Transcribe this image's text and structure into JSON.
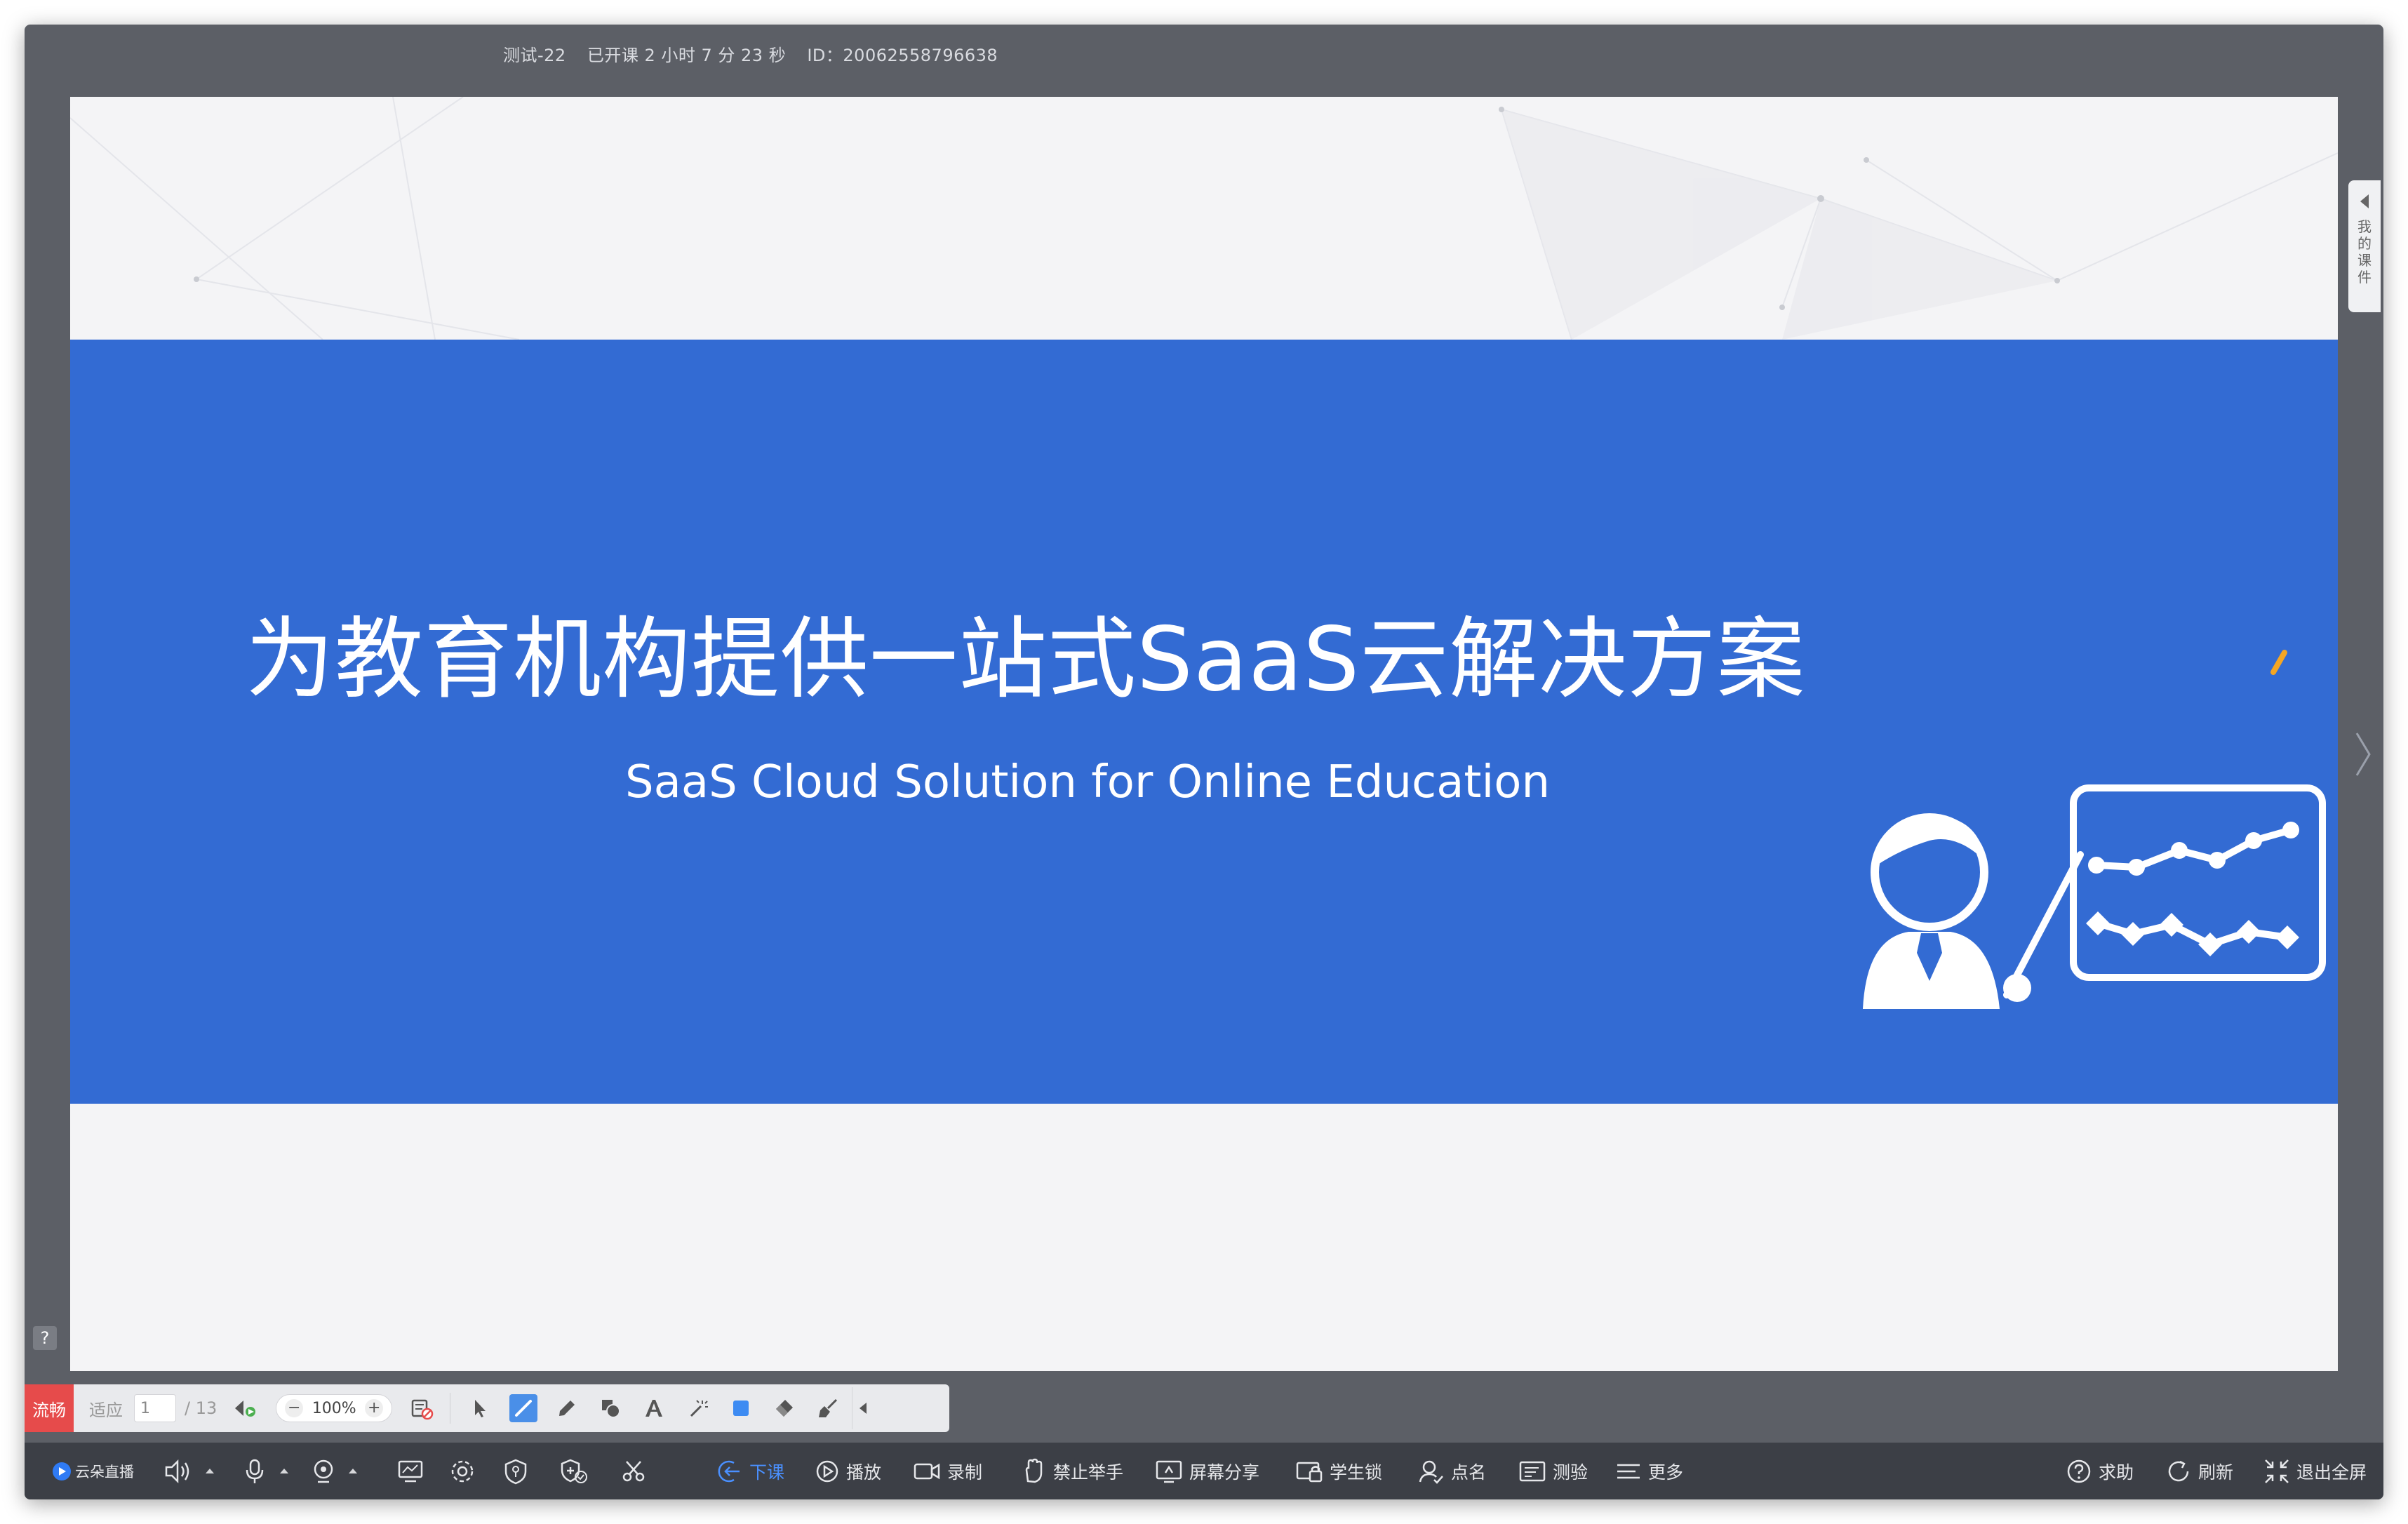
{
  "topbar": {
    "course_name": "测试-22",
    "elapsed": "已开课 2 小时 7 分 23 秒",
    "id_text": "ID：20062558796638"
  },
  "slide": {
    "title": "为教育机构提供一站式SaaS云解决方案",
    "subtitle": "SaaS Cloud Solution for Online Education",
    "band_color": "#336bd3"
  },
  "side_panel": {
    "label": "我的课件"
  },
  "slide_toolbar": {
    "smooth_label": "流畅",
    "fit_label": "适应",
    "page_value": "1",
    "page_total": "/ 13",
    "zoom_minus": "−",
    "zoom_value": "100%",
    "zoom_plus": "+",
    "tools": [
      "pointer-icon",
      "line-icon",
      "pen-icon",
      "shape-icon",
      "text-icon",
      "laser-icon",
      "color-icon",
      "eraser-icon",
      "clear-icon"
    ],
    "smooth_color": "#e64b4b"
  },
  "bottombar": {
    "brand": "云朵直播",
    "end_class": "下课",
    "play": "播放",
    "record": "录制",
    "ban_hand": "禁止举手",
    "screen_share": "屏幕分享",
    "student_lock": "学生锁",
    "roll_call": "点名",
    "quiz": "测验",
    "more": "更多",
    "help": "求助",
    "refresh": "刷新",
    "exit_fullscreen": "退出全屏",
    "active_color": "#4a90ff"
  }
}
